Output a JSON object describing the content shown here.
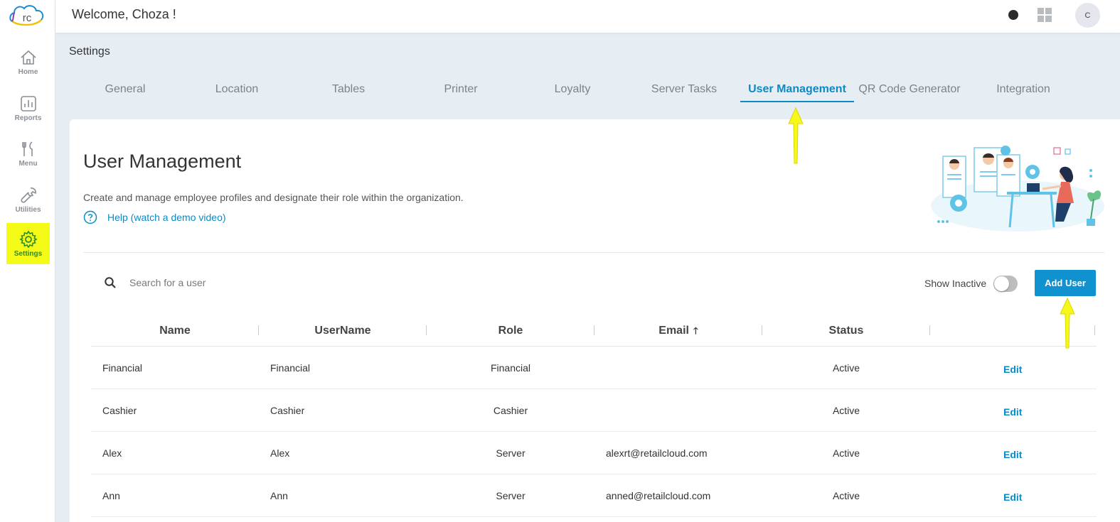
{
  "app": {
    "welcome_text": "Welcome, Choza !",
    "avatar_initial": "C",
    "logo_text": "rc"
  },
  "sidebar": {
    "items": [
      {
        "label": "Home",
        "icon": "home-icon"
      },
      {
        "label": "Reports",
        "icon": "reports-icon"
      },
      {
        "label": "Menu",
        "icon": "menu-icon"
      },
      {
        "label": "Utilities",
        "icon": "utilities-icon"
      },
      {
        "label": "Settings",
        "icon": "gear-icon",
        "active": true
      }
    ]
  },
  "settings": {
    "title": "Settings",
    "tabs": [
      "General",
      "Location",
      "Tables",
      "Printer",
      "Loyalty",
      "Server Tasks",
      "User Management",
      "QR Code Generator",
      "Integration"
    ],
    "active_tab": "User Management"
  },
  "page": {
    "title": "User Management",
    "description": "Create and manage employee profiles and designate their role within the organization.",
    "help_link": "Help (watch a demo video)"
  },
  "search": {
    "placeholder": "Search for a user"
  },
  "filters": {
    "show_inactive_label": "Show Inactive",
    "show_inactive": false
  },
  "actions": {
    "add_user_label": "Add User"
  },
  "table": {
    "columns": [
      "Name",
      "UserName",
      "Role",
      "Email",
      "Status"
    ],
    "sorted_by": "Email",
    "sort_direction": "ascending",
    "rows": [
      {
        "name": "Financial",
        "username": "Financial",
        "role": "Financial",
        "email": "",
        "status": "Active",
        "action": "Edit"
      },
      {
        "name": "Cashier",
        "username": "Cashier",
        "role": "Cashier",
        "email": "",
        "status": "Active",
        "action": "Edit"
      },
      {
        "name": "Alex",
        "username": "Alex",
        "role": "Server",
        "email": "alexrt@retailcloud.com",
        "status": "Active",
        "action": "Edit"
      },
      {
        "name": "Ann",
        "username": "Ann",
        "role": "Server",
        "email": "anned@retailcloud.com",
        "status": "Active",
        "action": "Edit"
      }
    ]
  },
  "colors": {
    "accent": "#0a8bc7",
    "button": "#1192d0",
    "highlight": "#f4fb16",
    "active_nav_text": "#2e8b2e"
  }
}
